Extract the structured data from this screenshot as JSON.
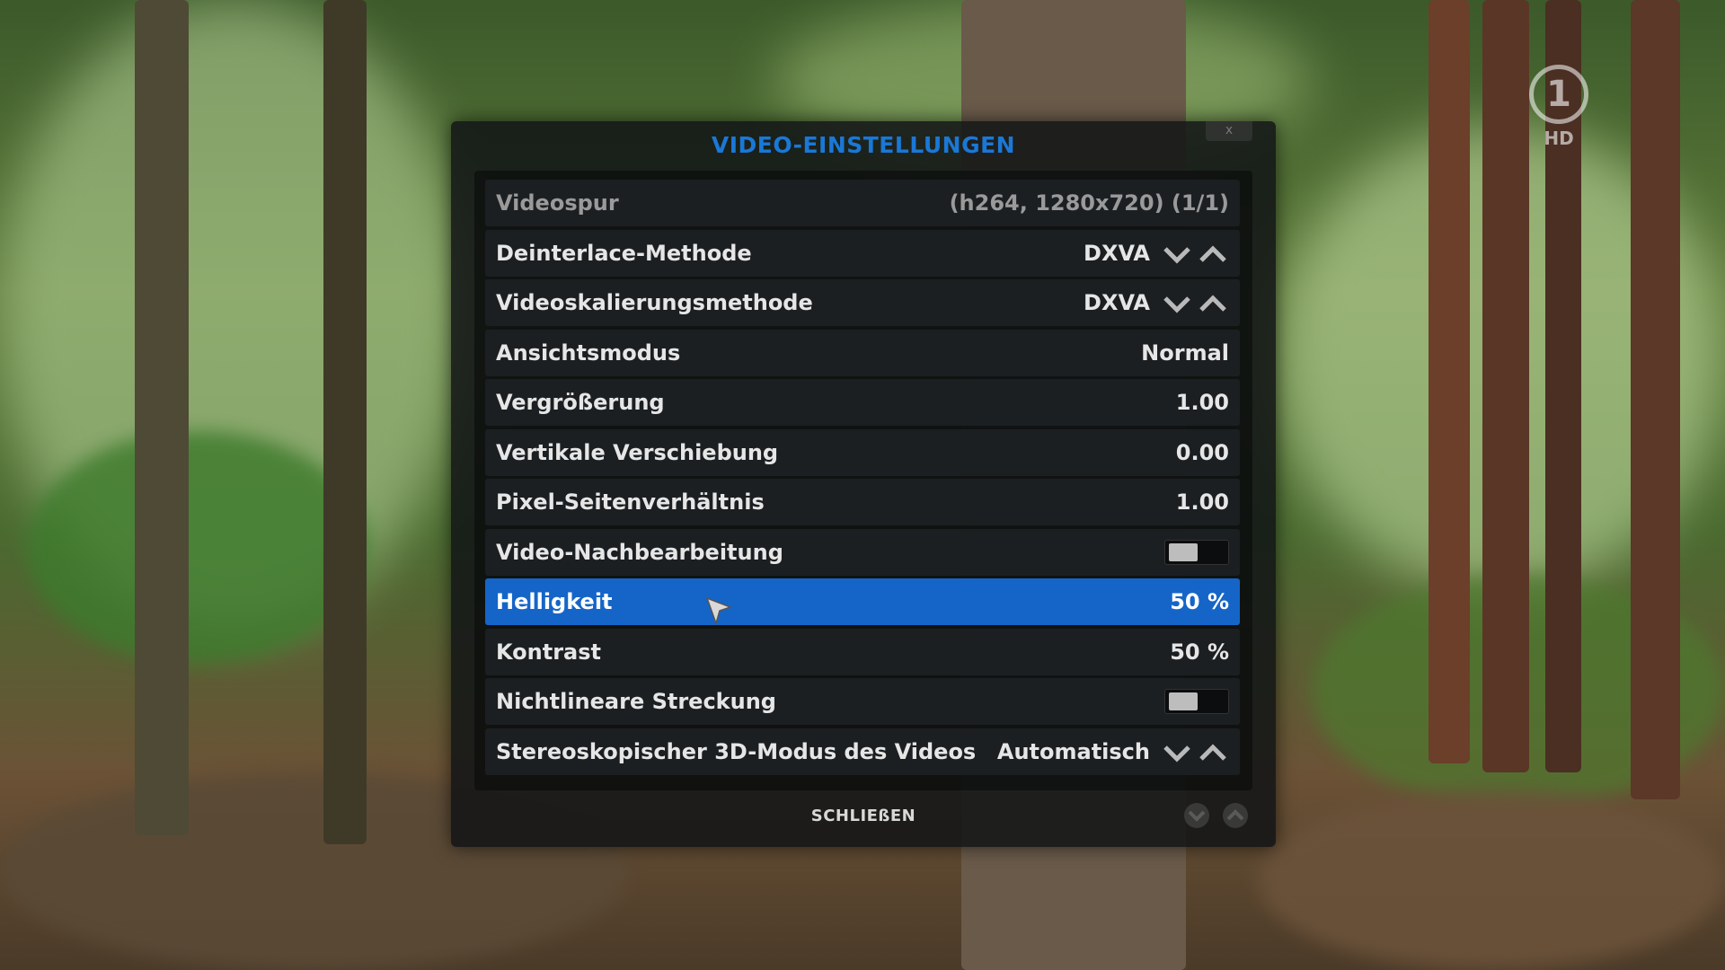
{
  "dialog": {
    "title": "VIDEO-EINSTELLUNGEN",
    "close_glyph": "x",
    "footer_close_label": "SCHLIEßEN"
  },
  "channel": {
    "logo_number": "1",
    "hd_label": "HD"
  },
  "rows": [
    {
      "label": "Videospur",
      "value": "(h264, 1280x720) (1/1)",
      "control": "text"
    },
    {
      "label": "Deinterlace-Methode",
      "value": "DXVA",
      "control": "spin"
    },
    {
      "label": "Videoskalierungsmethode",
      "value": "DXVA",
      "control": "spin"
    },
    {
      "label": "Ansichtsmodus",
      "value": "Normal",
      "control": "text"
    },
    {
      "label": "Vergrößerung",
      "value": "1.00",
      "control": "text"
    },
    {
      "label": "Vertikale Verschiebung",
      "value": "0.00",
      "control": "text"
    },
    {
      "label": "Pixel-Seitenverhältnis",
      "value": "1.00",
      "control": "text"
    },
    {
      "label": "Video-Nachbearbeitung",
      "value": "",
      "control": "toggle",
      "on": false
    },
    {
      "label": "Helligkeit",
      "value": "50 %",
      "control": "text",
      "selected": true
    },
    {
      "label": "Kontrast",
      "value": "50 %",
      "control": "text"
    },
    {
      "label": "Nichtlineare Streckung",
      "value": "",
      "control": "toggle",
      "on": false
    },
    {
      "label": "Stereoskopischer 3D-Modus des Videos",
      "value": "Automatisch",
      "control": "spin"
    }
  ],
  "colors": {
    "accent": "#1565c8",
    "title": "#1a78d6",
    "panel": "#121416"
  },
  "icons": {
    "spin_down": "chevron-down-icon",
    "spin_up": "chevron-up-icon",
    "pointer": "mouse-pointer-icon"
  }
}
